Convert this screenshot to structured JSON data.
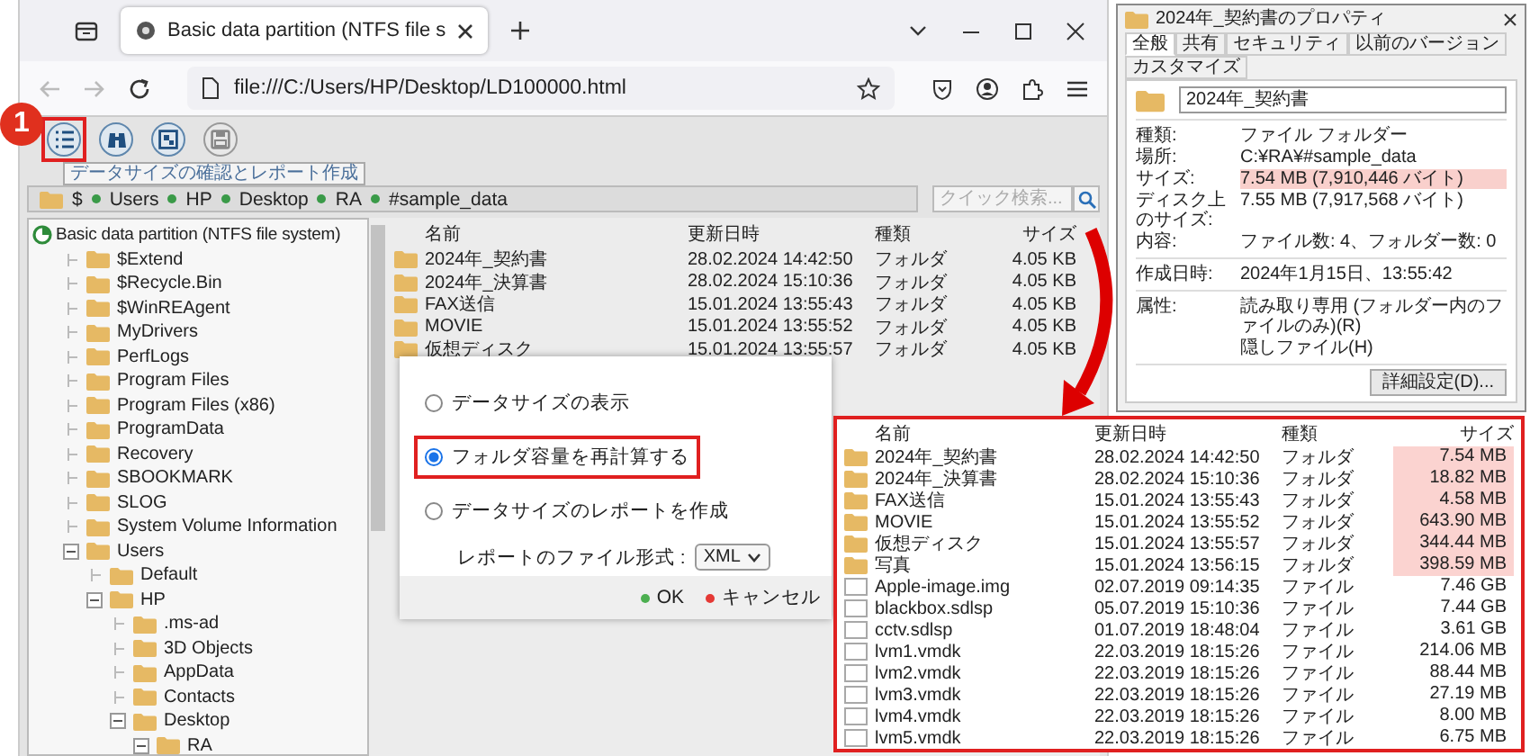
{
  "browser": {
    "tab_title": "Basic data partition (NTFS file s",
    "url": "file:///C:/Users/HP/Desktop/LD100000.html"
  },
  "callout": {
    "number": "1"
  },
  "toolbar": {
    "buttons": [
      {
        "kind": "list",
        "highlighted": true
      },
      {
        "kind": "binoculars",
        "highlighted": false
      },
      {
        "kind": "chart",
        "highlighted": false
      },
      {
        "kind": "save",
        "highlighted": false
      }
    ],
    "tooltip": "データサイズの確認とレポート作成"
  },
  "breadcrumb": [
    "$",
    "Users",
    "HP",
    "Desktop",
    "RA",
    "#sample_data"
  ],
  "quick_search": {
    "placeholder": "クイック検索..."
  },
  "tree": {
    "root": "Basic data partition (NTFS file system)",
    "items": [
      {
        "label": "$Extend",
        "expanded": false
      },
      {
        "label": "$Recycle.Bin",
        "expanded": false
      },
      {
        "label": "$WinREAgent",
        "expanded": false
      },
      {
        "label": "MyDrivers",
        "expanded": false
      },
      {
        "label": "PerfLogs",
        "expanded": false
      },
      {
        "label": "Program Files",
        "expanded": false
      },
      {
        "label": "Program Files (x86)",
        "expanded": false
      },
      {
        "label": "ProgramData",
        "expanded": false
      },
      {
        "label": "Recovery",
        "expanded": false
      },
      {
        "label": "SBOOKMARK",
        "expanded": false
      },
      {
        "label": "SLOG",
        "expanded": false
      },
      {
        "label": "System Volume Information",
        "expanded": false
      },
      {
        "label": "Users",
        "expanded": true,
        "children": [
          {
            "label": "Default",
            "expanded": false
          },
          {
            "label": "HP",
            "expanded": true,
            "children": [
              {
                "label": ".ms-ad",
                "expanded": false
              },
              {
                "label": "3D Objects",
                "expanded": false
              },
              {
                "label": "AppData",
                "expanded": false
              },
              {
                "label": "Contacts",
                "expanded": false
              },
              {
                "label": "Desktop",
                "expanded": true,
                "children": [
                  {
                    "label": "RA",
                    "expanded": true
                  }
                ]
              }
            ]
          }
        ]
      }
    ]
  },
  "file_list": {
    "columns": [
      "名前",
      "更新日時",
      "種類",
      "サイズ"
    ],
    "rows": [
      {
        "kind": "folder",
        "name": "2024年_契約書",
        "modified": "28.02.2024 14:42:50",
        "type": "フォルダ",
        "size": "4.05 KB"
      },
      {
        "kind": "folder",
        "name": "2024年_決算書",
        "modified": "28.02.2024 15:10:36",
        "type": "フォルダ",
        "size": "4.05 KB"
      },
      {
        "kind": "folder",
        "name": "FAX送信",
        "modified": "15.01.2024 13:55:43",
        "type": "フォルダ",
        "size": "4.05 KB"
      },
      {
        "kind": "folder",
        "name": "MOVIE",
        "modified": "15.01.2024 13:55:52",
        "type": "フォルダ",
        "size": "4.05 KB"
      },
      {
        "kind": "folder",
        "name": "仮想ディスク",
        "modified": "15.01.2024 13:55:57",
        "type": "フォルダ",
        "size": "4.05 KB"
      }
    ]
  },
  "dialog": {
    "options": [
      {
        "label": "データサイズの表示",
        "selected": false,
        "highlighted": false
      },
      {
        "label": "フォルダ容量を再計算する",
        "selected": true,
        "highlighted": true
      },
      {
        "label": "データサイズのレポートを作成",
        "selected": false,
        "highlighted": false
      }
    ],
    "format_label": "レポートのファイル形式 :",
    "format_value": "XML",
    "buttons": [
      {
        "label": "OK",
        "color": "#4caf50"
      },
      {
        "label": "キャンセル",
        "color": "#e53935"
      }
    ]
  },
  "zoomed_list": {
    "columns": [
      "名前",
      "更新日時",
      "種類",
      "サイズ"
    ],
    "rows": [
      {
        "kind": "folder",
        "name": "2024年_契約書",
        "modified": "28.02.2024 14:42:50",
        "type": "フォルダ",
        "size": "7.54 MB",
        "highlighted": true
      },
      {
        "kind": "folder",
        "name": "2024年_決算書",
        "modified": "28.02.2024 15:10:36",
        "type": "フォルダ",
        "size": "18.82 MB",
        "highlighted": true
      },
      {
        "kind": "folder",
        "name": "FAX送信",
        "modified": "15.01.2024 13:55:43",
        "type": "フォルダ",
        "size": "4.58 MB",
        "highlighted": true
      },
      {
        "kind": "folder",
        "name": "MOVIE",
        "modified": "15.01.2024 13:55:52",
        "type": "フォルダ",
        "size": "643.90 MB",
        "highlighted": true
      },
      {
        "kind": "folder",
        "name": "仮想ディスク",
        "modified": "15.01.2024 13:55:57",
        "type": "フォルダ",
        "size": "344.44 MB",
        "highlighted": true
      },
      {
        "kind": "folder",
        "name": "写真",
        "modified": "15.01.2024 13:56:15",
        "type": "フォルダ",
        "size": "398.59 MB",
        "highlighted": true
      },
      {
        "kind": "file",
        "name": "Apple-image.img",
        "modified": "02.07.2019 09:14:35",
        "type": "ファイル",
        "size": "7.46 GB",
        "highlighted": false
      },
      {
        "kind": "file",
        "name": "blackbox.sdlsp",
        "modified": "05.07.2019 15:10:36",
        "type": "ファイル",
        "size": "7.44 GB",
        "highlighted": false
      },
      {
        "kind": "file",
        "name": "cctv.sdlsp",
        "modified": "01.07.2019 18:48:04",
        "type": "ファイル",
        "size": "3.61 GB",
        "highlighted": false
      },
      {
        "kind": "file",
        "name": "lvm1.vmdk",
        "modified": "22.03.2019 18:15:26",
        "type": "ファイル",
        "size": "214.06 MB",
        "highlighted": false
      },
      {
        "kind": "file",
        "name": "lvm2.vmdk",
        "modified": "22.03.2019 18:15:26",
        "type": "ファイル",
        "size": "88.44 MB",
        "highlighted": false
      },
      {
        "kind": "file",
        "name": "lvm3.vmdk",
        "modified": "22.03.2019 18:15:26",
        "type": "ファイル",
        "size": "27.19 MB",
        "highlighted": false
      },
      {
        "kind": "file",
        "name": "lvm4.vmdk",
        "modified": "22.03.2019 18:15:26",
        "type": "ファイル",
        "size": "8.00 MB",
        "highlighted": false
      },
      {
        "kind": "file",
        "name": "lvm5.vmdk",
        "modified": "22.03.2019 18:15:26",
        "type": "ファイル",
        "size": "6.75 MB",
        "highlighted": false
      }
    ]
  },
  "properties": {
    "title": "2024年_契約書のプロパティ",
    "tabs": [
      {
        "label": "全般",
        "selected": true
      },
      {
        "label": "共有",
        "selected": false
      },
      {
        "label": "セキュリティ",
        "selected": false
      },
      {
        "label": "以前のバージョン",
        "selected": false
      },
      {
        "label": "カスタマイズ",
        "selected": false
      }
    ],
    "name": "2024年_契約書",
    "sections": [
      {
        "fields": [
          {
            "label": "種類:",
            "value": "ファイル フォルダー",
            "highlighted": false
          },
          {
            "label": "場所:",
            "value": "C:¥RA¥#sample_data",
            "highlighted": false
          },
          {
            "label": "サイズ:",
            "value": "7.54 MB (7,910,446 バイト)",
            "highlighted": true
          },
          {
            "label": "ディスク上のサイズ:",
            "value": "7.55 MB (7,917,568 バイト)",
            "highlighted": false
          },
          {
            "label": "内容:",
            "value": "ファイル数: 4、フォルダー数: 0",
            "highlighted": false
          }
        ]
      },
      {
        "fields": [
          {
            "label": "作成日時:",
            "value": "2024年1月15日、13:55:42",
            "highlighted": false
          }
        ]
      },
      {
        "fields": [
          {
            "label": "属性:",
            "value": "読み取り専用 (フォルダー内のファイルのみ)(R)",
            "highlighted": false
          },
          {
            "value": "隠しファイル(H)",
            "highlighted": false
          }
        ]
      }
    ],
    "advanced_button": "詳細設定(D)..."
  }
}
